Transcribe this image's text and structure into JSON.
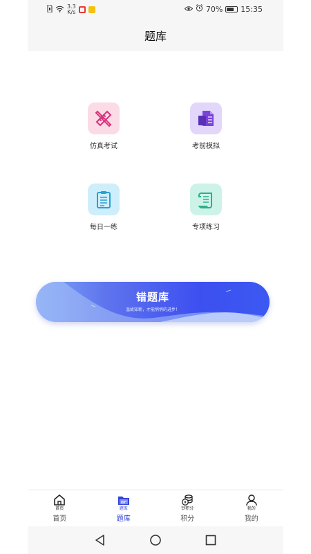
{
  "status_bar": {
    "net_speed_value": "3.3",
    "net_speed_unit": "K/s",
    "battery": "70%",
    "time": "15:35"
  },
  "header": {
    "title": "题库"
  },
  "grid": {
    "items": [
      {
        "label": "仿真考试",
        "icon": "pencil-ruler-icon",
        "bg": "#fbdbe6",
        "color": "#d6337a"
      },
      {
        "label": "考前模拟",
        "icon": "documents-icon",
        "bg": "#e2d6fb",
        "color": "#7b44d6"
      },
      {
        "label": "每日一练",
        "icon": "clipboard-icon",
        "bg": "#cfeefb",
        "color": "#2a9fd2"
      },
      {
        "label": "专项练习",
        "icon": "scroll-icon",
        "bg": "#cdf3e8",
        "color": "#2fae8a"
      }
    ]
  },
  "banner": {
    "title": "错题库",
    "subtitle": "温故知新，才能悄悄的进步！"
  },
  "tabbar": {
    "tabs": [
      {
        "small": "首页",
        "label": "首页",
        "icon": "home-icon"
      },
      {
        "small": "题库",
        "label": "题库",
        "icon": "folder-icon",
        "active": true
      },
      {
        "small": "钞积分",
        "label": "积分",
        "icon": "coins-icon"
      },
      {
        "small": "我的",
        "label": "我的",
        "icon": "user-icon"
      }
    ]
  },
  "colors": {
    "accent": "#2f3fd6",
    "banner_start": "#7fa7f5",
    "banner_end": "#3b59f2"
  }
}
